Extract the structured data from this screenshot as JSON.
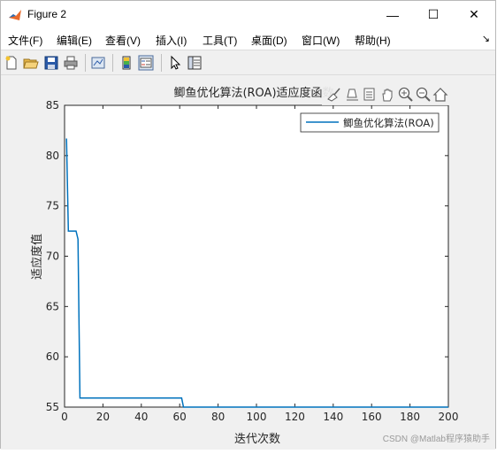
{
  "window": {
    "title": "Figure 2",
    "controls": {
      "minimize": "—",
      "maximize": "☐",
      "close": "✕"
    }
  },
  "menu": {
    "items": [
      "文件(F)",
      "编辑(E)",
      "查看(V)",
      "插入(I)",
      "工具(T)",
      "桌面(D)",
      "窗口(W)",
      "帮助(H)"
    ],
    "overflow": "↘"
  },
  "toolbar": {
    "buttons": [
      "new-figure-icon",
      "open-file-icon",
      "save-icon",
      "print-icon",
      "link-plot-icon",
      "colorbar-icon",
      "legend-icon",
      "pointer-icon",
      "property-editor-icon"
    ]
  },
  "axes_toolbar": {
    "buttons": [
      "brush-icon",
      "data-tips-icon",
      "export-icon",
      "pan-icon",
      "zoom-in-icon",
      "zoom-out-icon",
      "home-icon"
    ]
  },
  "watermark": "CSDN @Matlab程序猿助手",
  "chart_data": {
    "type": "line",
    "title": "鲫鱼优化算法(ROA)适应度函数",
    "xlabel": "迭代次数",
    "ylabel": "适应度值",
    "xlim": [
      0,
      200
    ],
    "ylim": [
      55,
      85
    ],
    "xticks": [
      0,
      20,
      40,
      60,
      80,
      100,
      120,
      140,
      160,
      180,
      200
    ],
    "yticks": [
      55,
      60,
      65,
      70,
      75,
      80,
      85
    ],
    "grid": false,
    "legend": "top-right",
    "series": [
      {
        "name": "鲫鱼优化算法(ROA)",
        "color": "#0072bd",
        "x": [
          1,
          2,
          3,
          4,
          5,
          6,
          7,
          8,
          9,
          10,
          20,
          30,
          40,
          50,
          61,
          62,
          70,
          100,
          150,
          200
        ],
        "y": [
          81.7,
          72.5,
          72.5,
          72.5,
          72.5,
          72.5,
          71.7,
          55.9,
          55.9,
          55.9,
          55.9,
          55.9,
          55.9,
          55.9,
          55.9,
          55.0,
          55.0,
          55.0,
          55.0,
          55.0
        ]
      }
    ]
  }
}
